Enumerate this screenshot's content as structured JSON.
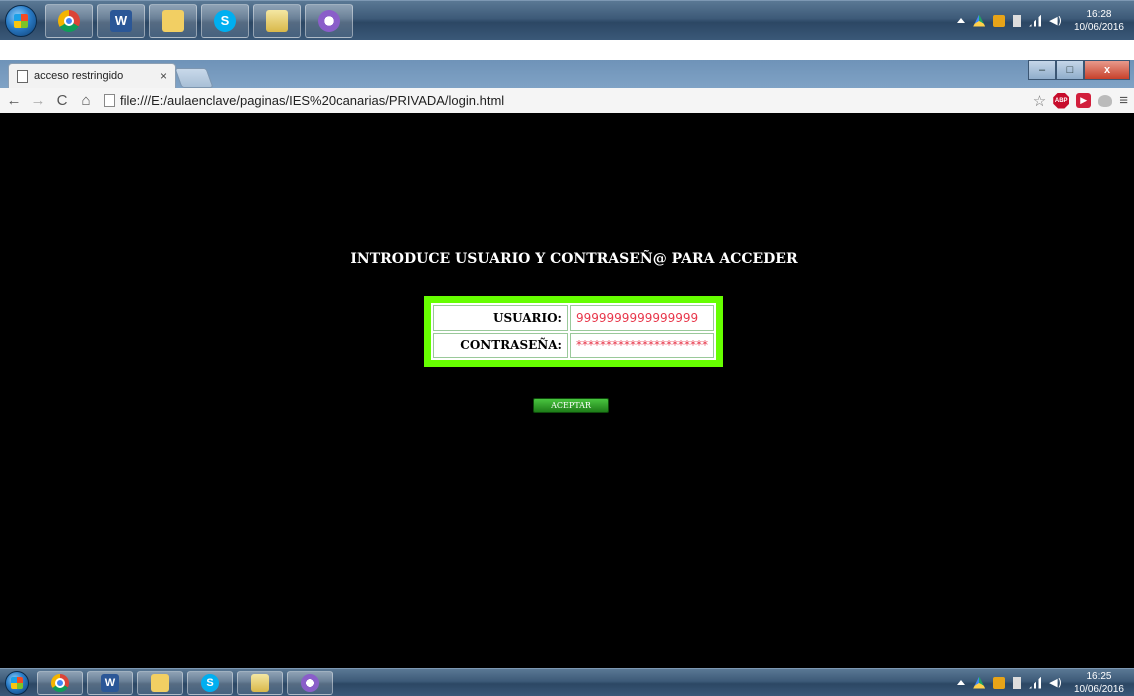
{
  "taskbar_top": {
    "clock_time": "16:28",
    "clock_date": "10/06/2016"
  },
  "taskbar_bottom": {
    "clock_time": "16:25",
    "clock_date": "10/06/2016"
  },
  "taskbar_apps": [
    "chrome-icon",
    "word-icon",
    "folder-icon",
    "skype-icon",
    "file-manager-icon",
    "paint-icon"
  ],
  "browser": {
    "tab_title": "acceso restringido",
    "tab_close": "×",
    "url": "file:///E:/aulaenclave/paginas/IES%20canarias/PRIVADA/login.html",
    "window_buttons": {
      "minimize": "–",
      "maximize": "□",
      "close": "x"
    }
  },
  "page": {
    "heading": "INTRODUCE USUARIO Y CONTRASEÑ@ PARA ACCEDER",
    "fields": [
      {
        "label": "USUARIO:",
        "value": "9999999999999999"
      },
      {
        "label": "CONTRASEÑA:",
        "value": "**********************"
      }
    ],
    "submit_label": "ACEPTAR"
  },
  "colors": {
    "page_background": "#000000",
    "login_border": "#66ff00",
    "field_text": "#e8364a",
    "button": "#2fa227"
  }
}
